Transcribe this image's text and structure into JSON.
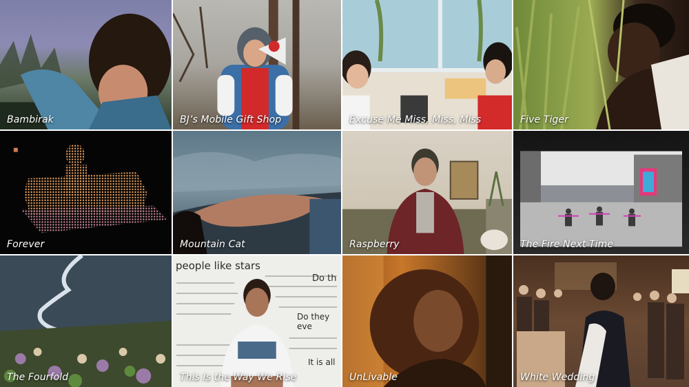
{
  "gallery": {
    "tiles": [
      {
        "title": "Bambirak"
      },
      {
        "title": "BJ’s Mobile Gift Shop"
      },
      {
        "title": "Excuse Me Miss, Miss, Miss"
      },
      {
        "title": "Five Tiger"
      },
      {
        "title": "Forever"
      },
      {
        "title": "Mountain Cat"
      },
      {
        "title": "Raspberry"
      },
      {
        "title": "The Fire Next Time"
      },
      {
        "title": "The Fourfold"
      },
      {
        "title": "This Is the Way We Rise"
      },
      {
        "title": "UnLivable"
      },
      {
        "title": "White Wedding"
      }
    ],
    "whiteboard": {
      "line1": "people like stars",
      "line2": "Do th",
      "line3": "Do they eve",
      "line4": "It is all"
    }
  }
}
